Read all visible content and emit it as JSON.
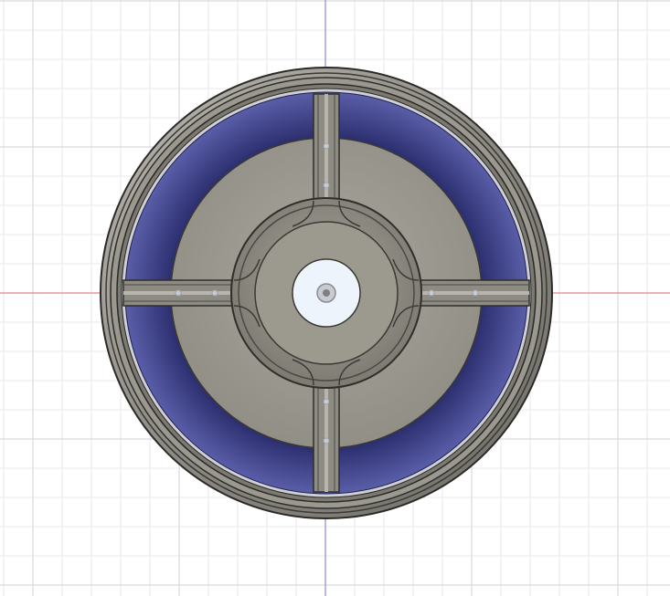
{
  "viewport": {
    "background_color": "#ffffff",
    "grid_minor_color": "#e9e9ec",
    "grid_major_color": "#d9d9de",
    "axis_x_color": "#e07070",
    "axis_y_color": "#7878e0"
  },
  "model": {
    "name": "wheel-rim",
    "view": "top",
    "body_color": "#8a8880",
    "body_dark_color": "#55534e",
    "face_color": "#a3a098",
    "pocket_color": "#3c3f83",
    "bore_color": "#eef4fb",
    "spoke_count": 4
  }
}
